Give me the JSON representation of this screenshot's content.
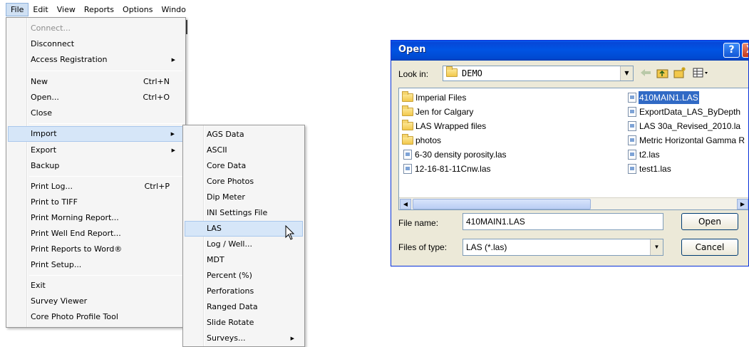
{
  "menubar": {
    "items": [
      {
        "label": "File"
      },
      {
        "label": "Edit"
      },
      {
        "label": "View"
      },
      {
        "label": "Reports"
      },
      {
        "label": "Options"
      },
      {
        "label": "Windo"
      }
    ]
  },
  "file_menu": {
    "items": [
      {
        "label": "Connect...",
        "shortcut": "",
        "disabled": true
      },
      {
        "label": "Disconnect",
        "shortcut": ""
      },
      {
        "label": "Access Registration",
        "shortcut": "",
        "submenu": true
      },
      {
        "label": "New",
        "shortcut": "Ctrl+N"
      },
      {
        "label": "Open...",
        "shortcut": "Ctrl+O"
      },
      {
        "label": "Close",
        "shortcut": ""
      },
      {
        "label": "Import",
        "shortcut": "",
        "submenu": true,
        "highlighted": true
      },
      {
        "label": "Export",
        "shortcut": "",
        "submenu": true
      },
      {
        "label": "Backup",
        "shortcut": ""
      },
      {
        "label": "Print Log...",
        "shortcut": "Ctrl+P"
      },
      {
        "label": "Print to TIFF",
        "shortcut": ""
      },
      {
        "label": "Print Morning Report...",
        "shortcut": ""
      },
      {
        "label": "Print Well End Report...",
        "shortcut": ""
      },
      {
        "label": "Print Reports to Word®",
        "shortcut": ""
      },
      {
        "label": "Print Setup...",
        "shortcut": ""
      },
      {
        "label": "Exit",
        "shortcut": ""
      },
      {
        "label": "Survey Viewer",
        "shortcut": ""
      },
      {
        "label": "Core Photo Profile Tool",
        "shortcut": ""
      }
    ]
  },
  "import_submenu": {
    "items": [
      {
        "label": "AGS Data"
      },
      {
        "label": "ASCII"
      },
      {
        "label": "Core Data"
      },
      {
        "label": "Core Photos"
      },
      {
        "label": "Dip Meter"
      },
      {
        "label": "INI Settings File"
      },
      {
        "label": "LAS",
        "highlighted": true
      },
      {
        "label": "Log / Well..."
      },
      {
        "label": "MDT"
      },
      {
        "label": "Percent (%)"
      },
      {
        "label": "Perforations"
      },
      {
        "label": "Ranged Data"
      },
      {
        "label": "Slide Rotate"
      },
      {
        "label": "Surveys...",
        "submenu": true
      }
    ]
  },
  "dialog": {
    "title": "Open",
    "help_label": "?",
    "close_label": "X",
    "look_in_label": "Look in:",
    "look_in_value": "DEMO",
    "files": [
      {
        "name": "Imperial Files",
        "kind": "folder"
      },
      {
        "name": "Jen for Calgary",
        "kind": "folder"
      },
      {
        "name": "LAS Wrapped files",
        "kind": "folder"
      },
      {
        "name": "photos",
        "kind": "folder"
      },
      {
        "name": "6-30 density porosity.las",
        "kind": "file"
      },
      {
        "name": "12-16-81-11Cnw.las",
        "kind": "file"
      },
      {
        "name": "410MAIN1.LAS",
        "kind": "file",
        "selected": true
      },
      {
        "name": "ExportData_LAS_ByDepth",
        "kind": "file"
      },
      {
        "name": "LAS 30a_Revised_2010.la",
        "kind": "file"
      },
      {
        "name": "Metric Horizontal Gamma R",
        "kind": "file"
      },
      {
        "name": "t2.las",
        "kind": "file"
      },
      {
        "name": "test1.las",
        "kind": "file"
      }
    ],
    "file_name_label": "File name:",
    "file_name_value": "410MAIN1.LAS",
    "file_type_label": "Files of type:",
    "file_type_value": "LAS (*.las)",
    "open_button": "Open",
    "cancel_button": "Cancel",
    "accent_color": "#0054e3",
    "selection_color": "#316ac5"
  }
}
